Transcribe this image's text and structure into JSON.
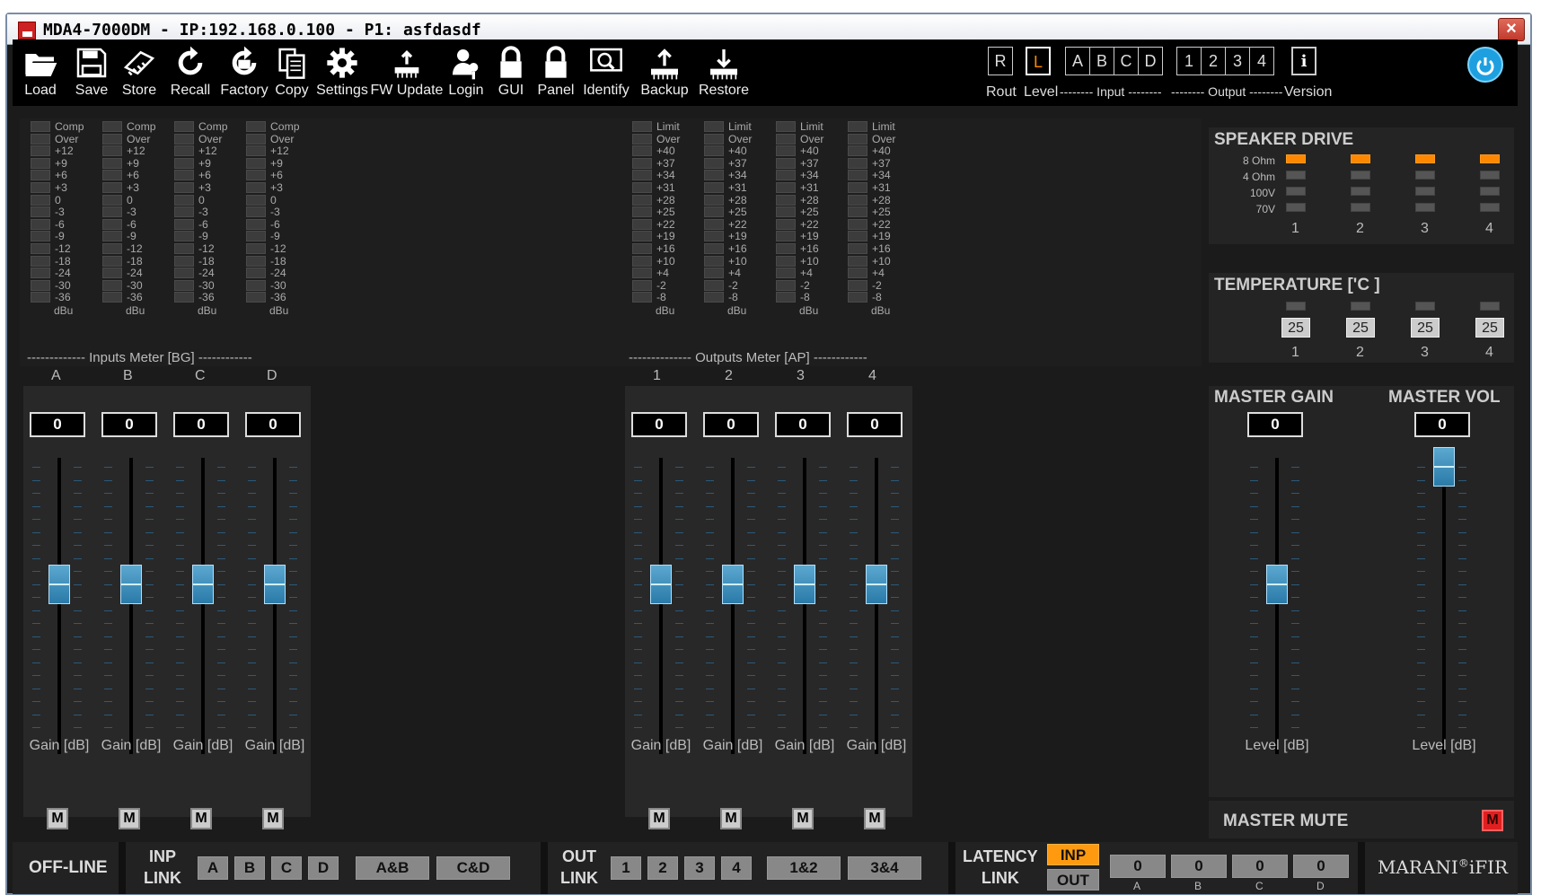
{
  "window": {
    "title": "MDA4-7000DM - IP:192.168.0.100 - P1: asfdasdf",
    "close": "×"
  },
  "toolbar": {
    "items": [
      {
        "label": "Load",
        "icon": "folder-open-icon"
      },
      {
        "label": "Save",
        "icon": "floppy-icon"
      },
      {
        "label": "Store",
        "icon": "chip-icon"
      },
      {
        "label": "Recall",
        "icon": "refresh-icon"
      },
      {
        "label": "Factory",
        "icon": "factory-reset-icon"
      },
      {
        "label": "Copy",
        "icon": "copy-icon"
      },
      {
        "label": "Settings",
        "icon": "gear-icon"
      },
      {
        "label": "FW Update",
        "icon": "firmware-chip-icon"
      },
      {
        "label": "Login",
        "icon": "user-key-icon"
      },
      {
        "label": "GUI",
        "icon": "lock-icon"
      },
      {
        "label": "Panel",
        "icon": "lock-icon"
      },
      {
        "label": "Identify",
        "icon": "magnifier-icon"
      },
      {
        "label": "Backup",
        "icon": "upload-chip-icon"
      },
      {
        "label": "Restore",
        "icon": "download-chip-icon"
      }
    ],
    "rout": "R",
    "rout_label": "Rout",
    "level": "L",
    "level_label": "Level",
    "inputs": [
      "A",
      "B",
      "C",
      "D"
    ],
    "input_label": "-------- Input --------",
    "outputs": [
      "1",
      "2",
      "3",
      "4"
    ],
    "output_label": "-------- Output --------",
    "version": "i",
    "version_label": "Version"
  },
  "meters": {
    "input_label": "------------- Inputs Meter [BG] ------------",
    "output_label": "-------------- Outputs Meter [AP] ------------",
    "input_scale": [
      "Comp",
      "Over",
      "+12",
      "+9",
      "+6",
      "+3",
      "0",
      "-3",
      "-6",
      "-9",
      "-12",
      "-18",
      "-24",
      "-30",
      "-36"
    ],
    "output_scale": [
      "Limit",
      "Over",
      "+40",
      "+37",
      "+34",
      "+31",
      "+28",
      "+25",
      "+22",
      "+19",
      "+16",
      "+10",
      "+4",
      "-2",
      "-8"
    ],
    "unit": "dBu"
  },
  "inputs": [
    {
      "name": "A",
      "gain": "0"
    },
    {
      "name": "B",
      "gain": "0"
    },
    {
      "name": "C",
      "gain": "0"
    },
    {
      "name": "D",
      "gain": "0"
    }
  ],
  "outputs": [
    {
      "name": "1",
      "gain": "0"
    },
    {
      "name": "2",
      "gain": "0"
    },
    {
      "name": "3",
      "gain": "0"
    },
    {
      "name": "4",
      "gain": "0"
    }
  ],
  "gain_label": "Gain [dB]",
  "mute": "M",
  "speaker_drive": {
    "title": "SPEAKER DRIVE",
    "rows": [
      "8 Ohm",
      "4 Ohm",
      "100V",
      "70V"
    ],
    "channels": [
      "1",
      "2",
      "3",
      "4"
    ],
    "selected": "8 Ohm"
  },
  "temperature": {
    "title": "TEMPERATURE ['C ]",
    "values": [
      "25",
      "25",
      "25",
      "25"
    ],
    "channels": [
      "1",
      "2",
      "3",
      "4"
    ]
  },
  "master": {
    "gain_title": "MASTER GAIN",
    "vol_title": "MASTER VOL",
    "gain": "0",
    "vol": "0",
    "level_label": "Level [dB]",
    "mute_label": "MASTER MUTE",
    "mute": "M",
    "gain_level": 0.55,
    "vol_level": 1.0
  },
  "bottom": {
    "status": "OFF-LINE",
    "inp_link": "INP\nLINK",
    "inp_btns": [
      "A",
      "B",
      "C",
      "D"
    ],
    "inp_pairs": [
      "A&B",
      "C&D"
    ],
    "out_link": "OUT\nLINK",
    "out_btns": [
      "1",
      "2",
      "3",
      "4"
    ],
    "out_pairs": [
      "1&2",
      "3&4"
    ],
    "latency": "LATENCY\nLINK",
    "lat_inp": "INP",
    "lat_out": "OUT",
    "lat_values": [
      "0",
      "0",
      "0",
      "0"
    ],
    "lat_letters": [
      "A",
      "B",
      "C",
      "D"
    ],
    "brand": "MARANI",
    "brand_reg": "®",
    "brand_sub": "iFIR"
  },
  "colors": {
    "accent": "#ff8800",
    "mute_active": "#e02020",
    "knob": "#3a90c0"
  }
}
